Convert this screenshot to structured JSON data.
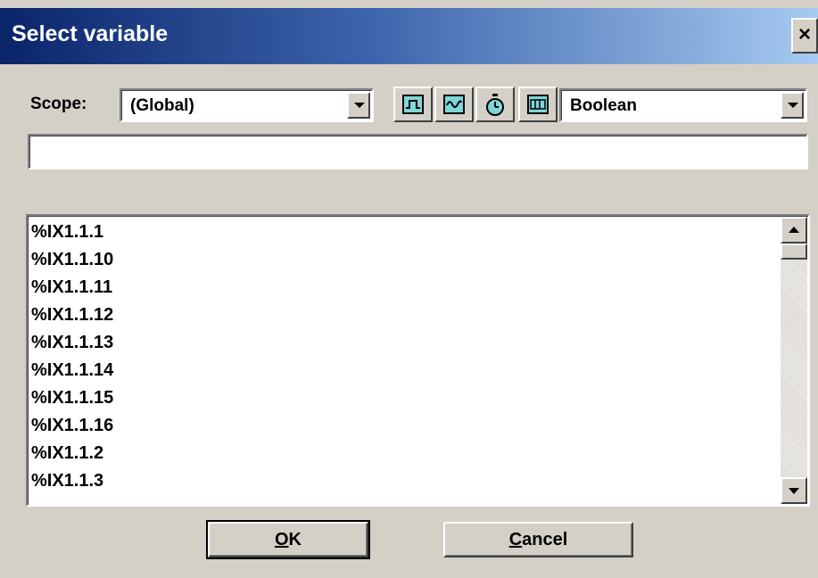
{
  "dialog": {
    "title": "Select variable",
    "close_glyph": "×"
  },
  "scope": {
    "label": "Scope:",
    "value": "(Global)"
  },
  "type_filter": {
    "value": "Boolean"
  },
  "toolbar_icons": [
    "digital-signal-icon",
    "analog-signal-icon",
    "timer-icon",
    "structure-icon"
  ],
  "filter_input": {
    "value": ""
  },
  "variables": [
    "%IX1.1.1",
    "%IX1.1.10",
    "%IX1.1.11",
    "%IX1.1.12",
    "%IX1.1.13",
    "%IX1.1.14",
    "%IX1.1.15",
    "%IX1.1.16",
    "%IX1.1.2",
    "%IX1.1.3"
  ],
  "buttons": {
    "ok_mnemonic": "O",
    "ok_rest": "K",
    "cancel_mnemonic": "C",
    "cancel_rest": "ancel"
  },
  "colors": {
    "titlebar_start": "#0a246a",
    "titlebar_end": "#a6caf0",
    "face": "#d4d0c8",
    "icon_fill": "#7fd6d6"
  }
}
